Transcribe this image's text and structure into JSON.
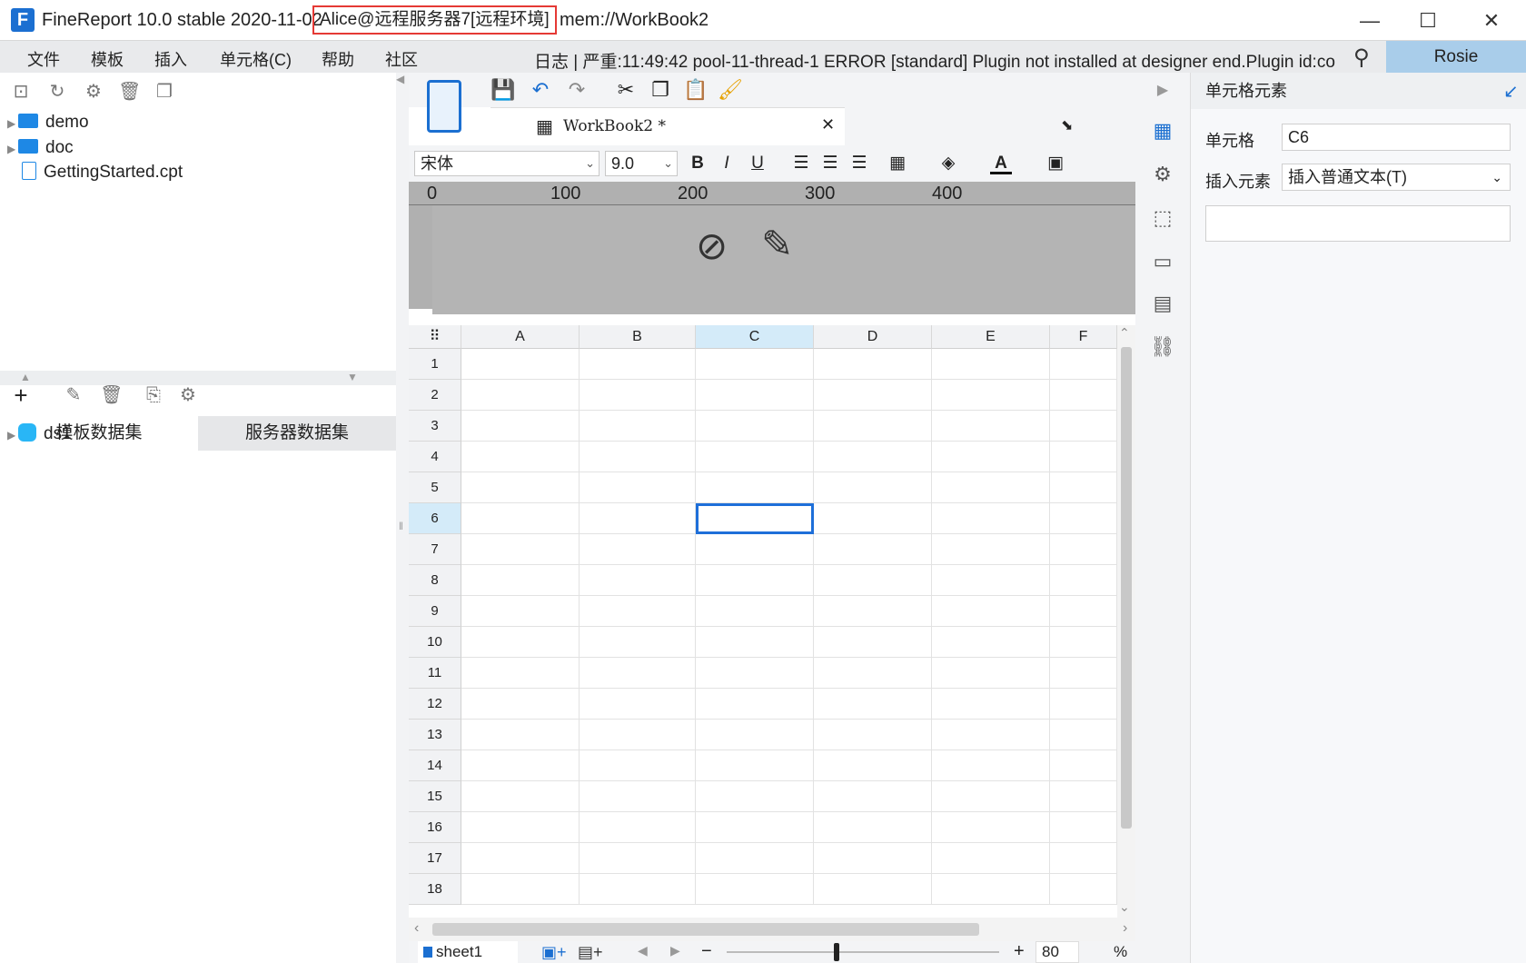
{
  "title": {
    "app": "FineReport 10.0 stable 2020-11-02",
    "user_env": "Alice@远程服务器7[远程环境]",
    "file": "mem://WorkBook2"
  },
  "window_controls": {
    "min": "—",
    "max": "☐",
    "close": "✕"
  },
  "menu": {
    "items": [
      "文件",
      "模板",
      "插入",
      "单元格(C)",
      "帮助",
      "社区"
    ],
    "log": "日志 | 严重:11:49:42 pool-11-thread-1 ERROR [standard] Plugin not installed at designer end.Plugin id:co",
    "user": "Rosie"
  },
  "file_tree": [
    {
      "label": "demo",
      "type": "folder"
    },
    {
      "label": "doc",
      "type": "folder"
    },
    {
      "label": "GettingStarted.cpt",
      "type": "file"
    }
  ],
  "dataset_tabs": [
    "模板数据集",
    "服务器数据集"
  ],
  "datasets": [
    {
      "label": "ds1"
    }
  ],
  "editor": {
    "tab_label": "WorkBook2 *",
    "font_name": "宋体",
    "font_size": "9.0",
    "ruler_labels": [
      "0",
      "100",
      "200",
      "300",
      "400"
    ],
    "columns": [
      "A",
      "B",
      "C",
      "D",
      "E",
      "F"
    ],
    "rows": [
      "1",
      "2",
      "3",
      "4",
      "5",
      "6",
      "7",
      "8",
      "9",
      "10",
      "11",
      "12",
      "13",
      "14",
      "15",
      "16",
      "17",
      "18"
    ],
    "selected_cell": "C6",
    "sheet": "sheet1",
    "zoom": "80",
    "zoom_unit": "%"
  },
  "props": {
    "header": "单元格元素",
    "cell_label": "单元格",
    "cell_value": "C6",
    "insert_label": "插入元素",
    "insert_value": "插入普通文本(T)"
  },
  "colors": {
    "accent": "#1b6fd1",
    "selected_border": "#1e6fd9",
    "user_highlight": "#a9cdea",
    "title_outline": "#e53935"
  }
}
